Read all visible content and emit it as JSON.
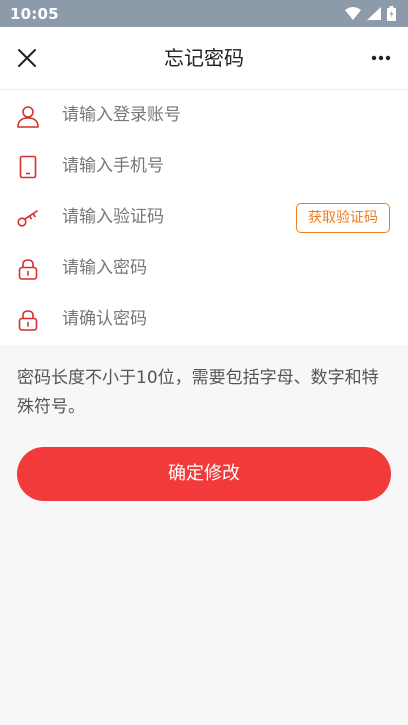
{
  "status_bar": {
    "time": "10:05"
  },
  "header": {
    "title": "忘记密码"
  },
  "form": {
    "account_placeholder": "请输入登录账号",
    "phone_placeholder": "请输入手机号",
    "code_placeholder": "请输入验证码",
    "get_code_label": "获取验证码",
    "password_placeholder": "请输入密码",
    "confirm_password_placeholder": "请确认密码"
  },
  "hint": "密码长度不小于10位，需要包括字母、数字和特殊符号。",
  "submit_label": "确定修改",
  "colors": {
    "accent_red": "#f23a3a",
    "orange": "#f07d1a",
    "icon_red": "#d62f2f"
  }
}
